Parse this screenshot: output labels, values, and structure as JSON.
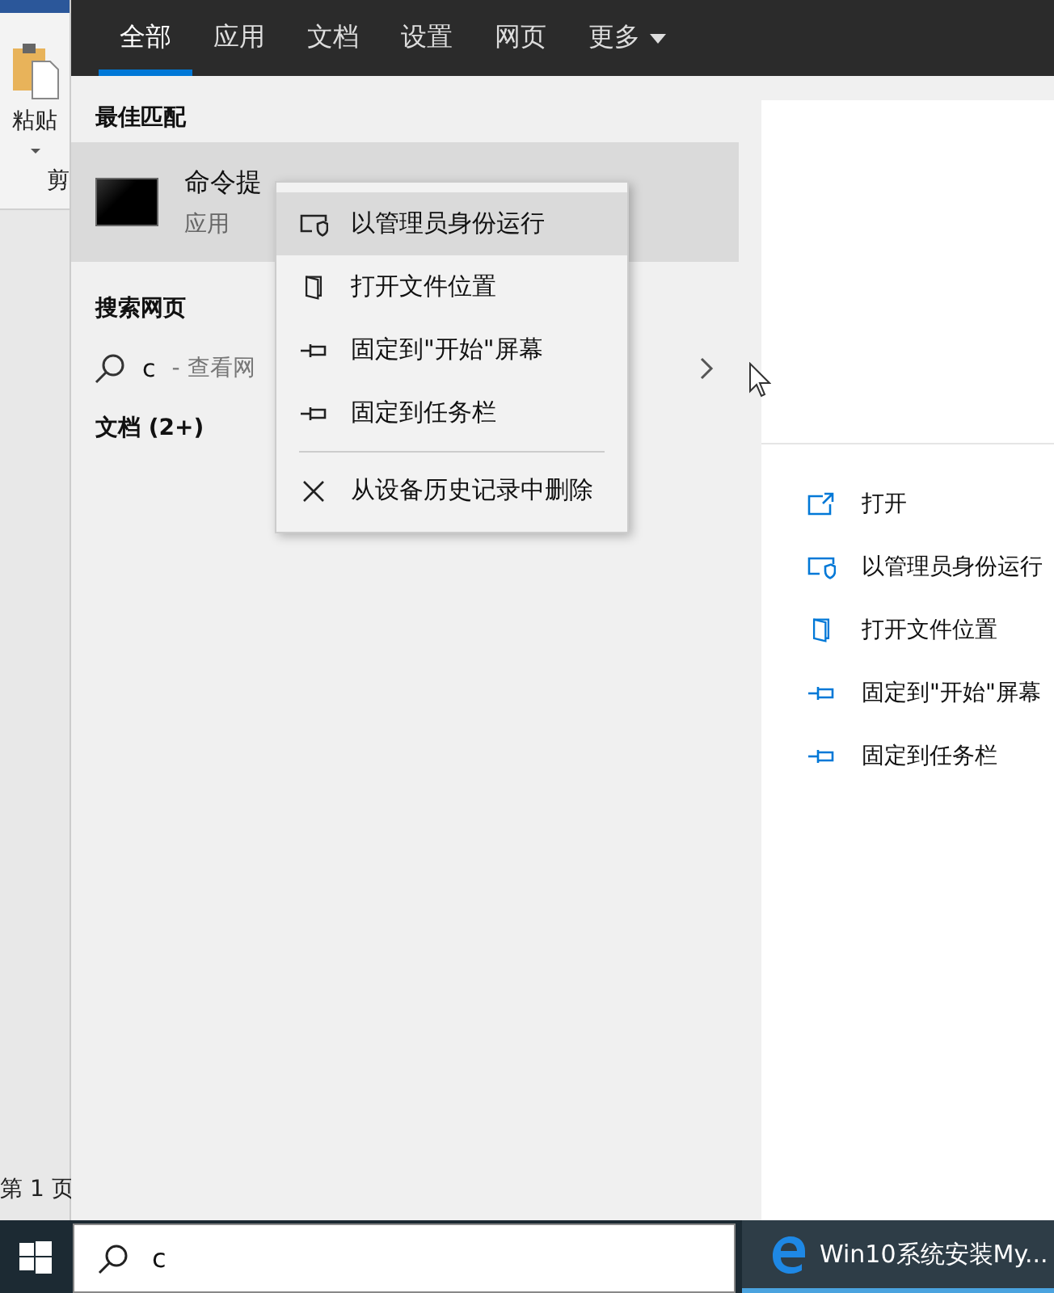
{
  "background_app": {
    "ribbon_label": "粘贴",
    "group_label": "剪",
    "status": "第 1 页"
  },
  "tabs": [
    {
      "label": "全部",
      "selected": true
    },
    {
      "label": "应用",
      "selected": false
    },
    {
      "label": "文档",
      "selected": false
    },
    {
      "label": "设置",
      "selected": false
    },
    {
      "label": "网页",
      "selected": false
    },
    {
      "label": "更多",
      "selected": false,
      "dropdown": true
    }
  ],
  "best_match": {
    "heading": "最佳匹配",
    "title": "命令提",
    "subtitle": "应用",
    "selected": true
  },
  "web_search": {
    "heading": "搜索网页",
    "query": "c",
    "hint": "- 查看网"
  },
  "documents": {
    "heading": "文档 (2+)"
  },
  "context_menu": {
    "items": [
      {
        "kind": "admin",
        "label": "以管理员身份运行",
        "selected": true
      },
      {
        "kind": "folder",
        "label": "打开文件位置",
        "selected": false
      },
      {
        "kind": "pin",
        "label": "固定到\"开始\"屏幕",
        "selected": false
      },
      {
        "kind": "pin",
        "label": "固定到任务栏",
        "selected": false
      },
      {
        "kind": "remove",
        "label": "从设备历史记录中删除",
        "selected": false,
        "separator_before": true
      }
    ]
  },
  "details": {
    "actions": [
      {
        "kind": "open",
        "label": "打开"
      },
      {
        "kind": "admin",
        "label": "以管理员身份运行"
      },
      {
        "kind": "folder",
        "label": "打开文件位置"
      },
      {
        "kind": "pin",
        "label": "固定到\"开始\"屏幕"
      },
      {
        "kind": "pin",
        "label": "固定到任务栏"
      }
    ]
  },
  "taskbar": {
    "search_value": "c",
    "app": {
      "label": "Win10系统安装My..."
    }
  }
}
